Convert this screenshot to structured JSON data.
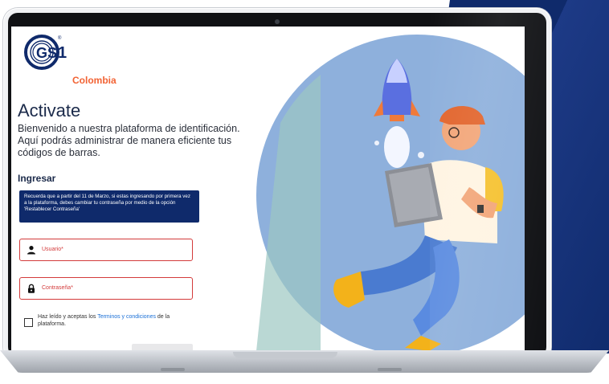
{
  "brand": {
    "logo_text": "GS1",
    "logo_country": "Colombia",
    "registered_mark": "®",
    "colors": {
      "navy": "#0f2a6b",
      "orange": "#f26334",
      "error_red": "#d33a3a",
      "link_blue": "#1a6fd6"
    }
  },
  "page": {
    "title": "Activate",
    "subtitle": "Bienvenido a nuestra plataforma de identificación. Aquí podrás administrar de manera eficiente tus códigos de barras."
  },
  "login": {
    "section_title": "Ingresar",
    "notice": "Recuerda que a partir del 11 de Marzo, si estas ingresando por primera vez a la plataforma, debes cambiar tu contraseña por medio de la opción 'Restablecer Contraseña'",
    "username": {
      "placeholder": "Usuario*",
      "icon": "user-icon"
    },
    "password": {
      "placeholder": "Contraseña*",
      "icon": "lock-icon"
    },
    "terms": {
      "prefix": "Haz leído y aceptas los ",
      "link": "Terminos y condiciones",
      "suffix": " de la plataforma."
    }
  }
}
